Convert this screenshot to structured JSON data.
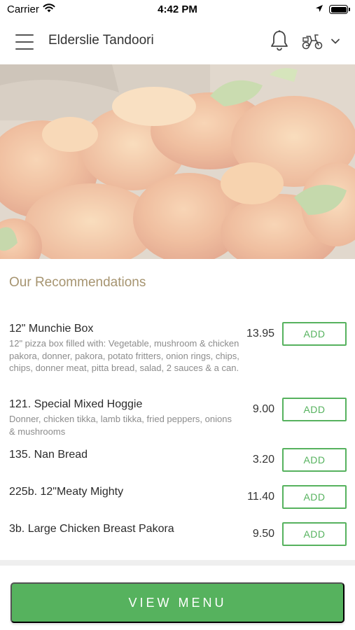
{
  "status_bar": {
    "carrier": "Carrier",
    "time": "4:42 PM",
    "icons": [
      "wifi-icon",
      "location-arrow-icon",
      "battery-icon"
    ]
  },
  "header": {
    "title": "Elderslie Tandoori",
    "icons": [
      "hamburger-menu-icon",
      "bell-icon",
      "moped-icon",
      "chevron-down-icon"
    ]
  },
  "hero": {
    "image": "tandoori-prawn-photo"
  },
  "recommendations": {
    "title": "Our Recommendations",
    "add_label": "ADD",
    "items": [
      {
        "name": "12\" Munchie Box",
        "description": "12\" pizza box filled with: Vegetable, mushroom & chicken pakora, donner, pakora, potato fritters, onion rings, chips, chips, donner meat, pitta bread, salad, 2 sauces & a can.",
        "price": "13.95"
      },
      {
        "name": "121. Special Mixed Hoggie",
        "description": "Donner, chicken tikka, lamb tikka, fried peppers, onions & mushrooms",
        "price": "9.00"
      },
      {
        "name": "135. Nan Bread",
        "description": "",
        "price": "3.20"
      },
      {
        "name": "225b. 12\"Meaty Mighty",
        "description": "",
        "price": "11.40"
      },
      {
        "name": "3b. Large Chicken Breast Pakora",
        "description": "",
        "price": "9.50"
      }
    ]
  },
  "bottom": {
    "view_menu_label": "VIEW MENU"
  },
  "colors": {
    "accent_green": "#56b25e",
    "section_title": "#a69470"
  }
}
